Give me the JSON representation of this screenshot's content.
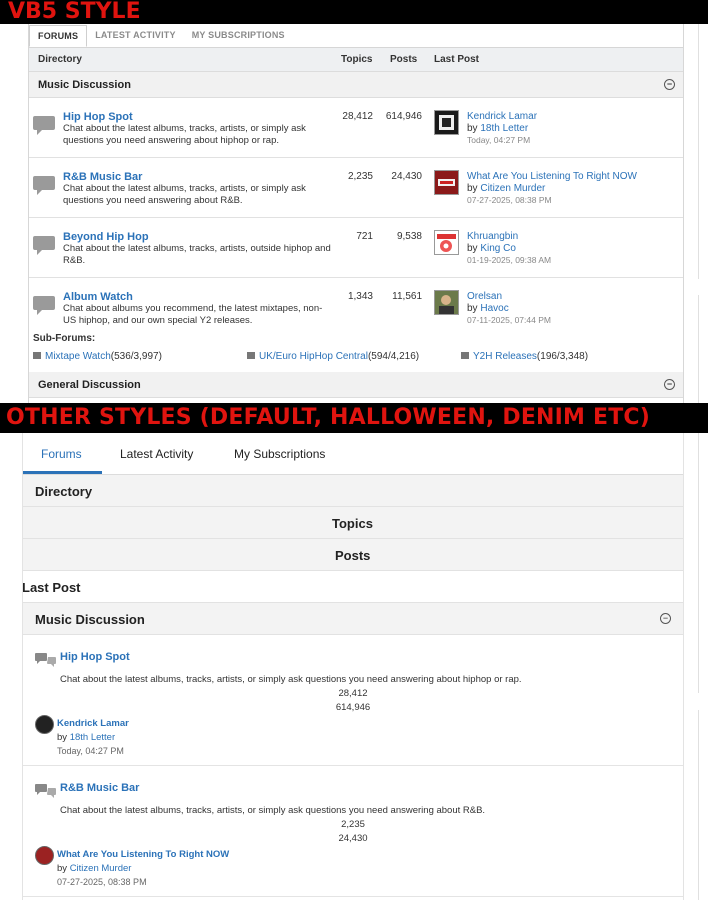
{
  "banners": {
    "top": "VB5 STYLE",
    "middle": "OTHER STYLES (DEFAULT, HALLOWEEN, DENIM ETC)"
  },
  "vb5": {
    "tabs": [
      "FORUMS",
      "LATEST ACTIVITY",
      "MY SUBSCRIPTIONS"
    ],
    "headers": {
      "directory": "Directory",
      "topics": "Topics",
      "posts": "Posts",
      "last_post": "Last Post"
    },
    "category": {
      "title": "Music Discussion",
      "toggle": "−"
    },
    "forums": [
      {
        "title": "Hip Hop Spot",
        "description": "Chat about the latest albums, tracks, artists, or simply ask questions you need answering about hiphop or rap.",
        "topics": "28,412",
        "posts": "614,946",
        "last_post_title": "Kendrick Lamar",
        "by": "by",
        "last_post_user": "18th Letter",
        "last_post_date": "Today, 04:27 PM",
        "avatar_icon": "album-cover-avatar"
      },
      {
        "title": "R&B Music Bar",
        "description": "Chat about the latest albums, tracks, artists, or simply ask questions you need answering about R&B.",
        "topics": "2,235",
        "posts": "24,430",
        "last_post_title": "What Are You Listening To Right NOW",
        "by": "by",
        "last_post_user": "Citizen Murder",
        "last_post_date": "07-27-2025, 08:38 PM",
        "avatar_icon": "album-cover-avatar"
      },
      {
        "title": "Beyond Hip Hop",
        "description": "Chat about the latest albums, tracks, artists, outside hiphop and R&B.",
        "topics": "721",
        "posts": "9,538",
        "last_post_title": "Khruangbin",
        "by": "by",
        "last_post_user": "King Co",
        "last_post_date": "01-19-2025, 09:38 AM",
        "avatar_icon": "album-cover-avatar"
      },
      {
        "title": "Album Watch",
        "description": "Chat about albums you recommend, the latest mixtapes, non-US hiphop, and our own special Y2 releases.",
        "topics": "1,343",
        "posts": "11,561",
        "last_post_title": "Orelsan",
        "by": "by",
        "last_post_user": "Havoc",
        "last_post_date": "07-11-2025, 07:44 PM",
        "avatar_icon": "album-cover-avatar"
      }
    ],
    "subforums_label": "Sub-Forums:",
    "subforums": [
      {
        "name": "Mixtape Watch",
        "counts": "(536/3,997)"
      },
      {
        "name": "UK/Euro HipHop Central",
        "counts": "(594/4,216)"
      },
      {
        "name": "Y2H Releases",
        "counts": "(196/3,348)"
      }
    ],
    "category2": {
      "title": "General Discussion",
      "toggle": "−"
    }
  },
  "other": {
    "tabs": [
      "Forums",
      "Latest Activity",
      "My Subscriptions"
    ],
    "headers": {
      "directory": "Directory",
      "topics": "Topics",
      "posts": "Posts",
      "last_post": "Last Post"
    },
    "category": {
      "title": "Music Discussion",
      "toggle": "−"
    },
    "forums": [
      {
        "title": "Hip Hop Spot",
        "description": "Chat about the latest albums, tracks, artists, or simply ask questions you need answering about hiphop or rap.",
        "topics": "28,412",
        "posts": "614,946",
        "last_post_title": "Kendrick Lamar",
        "by": "by",
        "last_post_user": "18th Letter",
        "last_post_date": "Today, 04:27 PM"
      },
      {
        "title": "R&B Music Bar",
        "description": "Chat about the latest albums, tracks, artists, or simply ask questions you need answering about R&B.",
        "topics": "2,235",
        "posts": "24,430",
        "last_post_title": "What Are You Listening To Right NOW",
        "by": "by",
        "last_post_user": "Citizen Murder",
        "last_post_date": "07-27-2025, 08:38 PM"
      }
    ]
  },
  "colors": {
    "banner_red": "#e0140f",
    "link_blue": "#2b72b8"
  }
}
